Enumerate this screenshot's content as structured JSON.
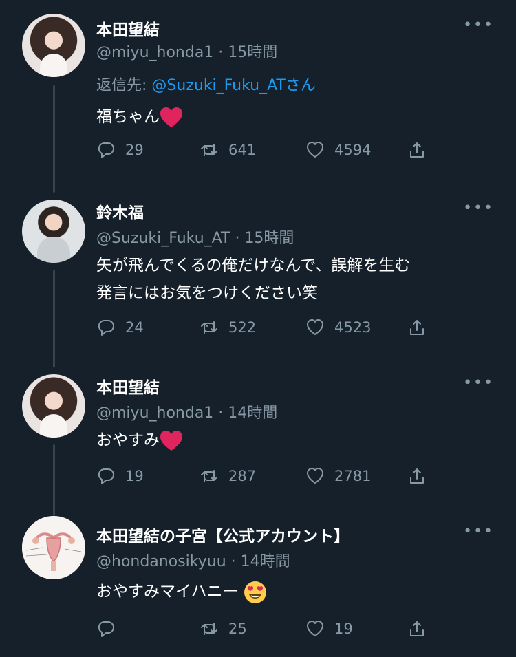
{
  "tweets": [
    {
      "name": "本田望結",
      "handle": "@miyu_honda1",
      "time": "15時間",
      "reply_label": "返信先:",
      "reply_to": "@Suzuki_Fuku_ATさん",
      "text": "福ちゃん",
      "emoji": "heart",
      "replies": "29",
      "retweets": "641",
      "likes": "4594"
    },
    {
      "name": "鈴木福",
      "handle": "@Suzuki_Fuku_AT",
      "time": "15時間",
      "text_line1": "矢が飛んでくるの俺だけなんで、誤解を生む",
      "text_line2": "発言にはお気をつけください笑",
      "replies": "24",
      "retweets": "522",
      "likes": "4523"
    },
    {
      "name": "本田望結",
      "handle": "@miyu_honda1",
      "time": "14時間",
      "text": "おやすみ",
      "emoji": "heart",
      "replies": "19",
      "retweets": "287",
      "likes": "2781"
    },
    {
      "name": "本田望結の子宮【公式アカウント】",
      "handle": "@hondanosikyuu",
      "time": "14時間",
      "text": "おやすみマイハニー",
      "emoji": "heart-eyes",
      "replies": "",
      "retweets": "25",
      "likes": "19"
    }
  ],
  "ui": {
    "separator": "·",
    "more_label": "•••"
  },
  "colors": {
    "background": "#15202b",
    "text": "#ffffff",
    "muted": "#8899a6",
    "link": "#1d9bf0",
    "thread_line": "#38444d",
    "heart": "#e0245e"
  }
}
